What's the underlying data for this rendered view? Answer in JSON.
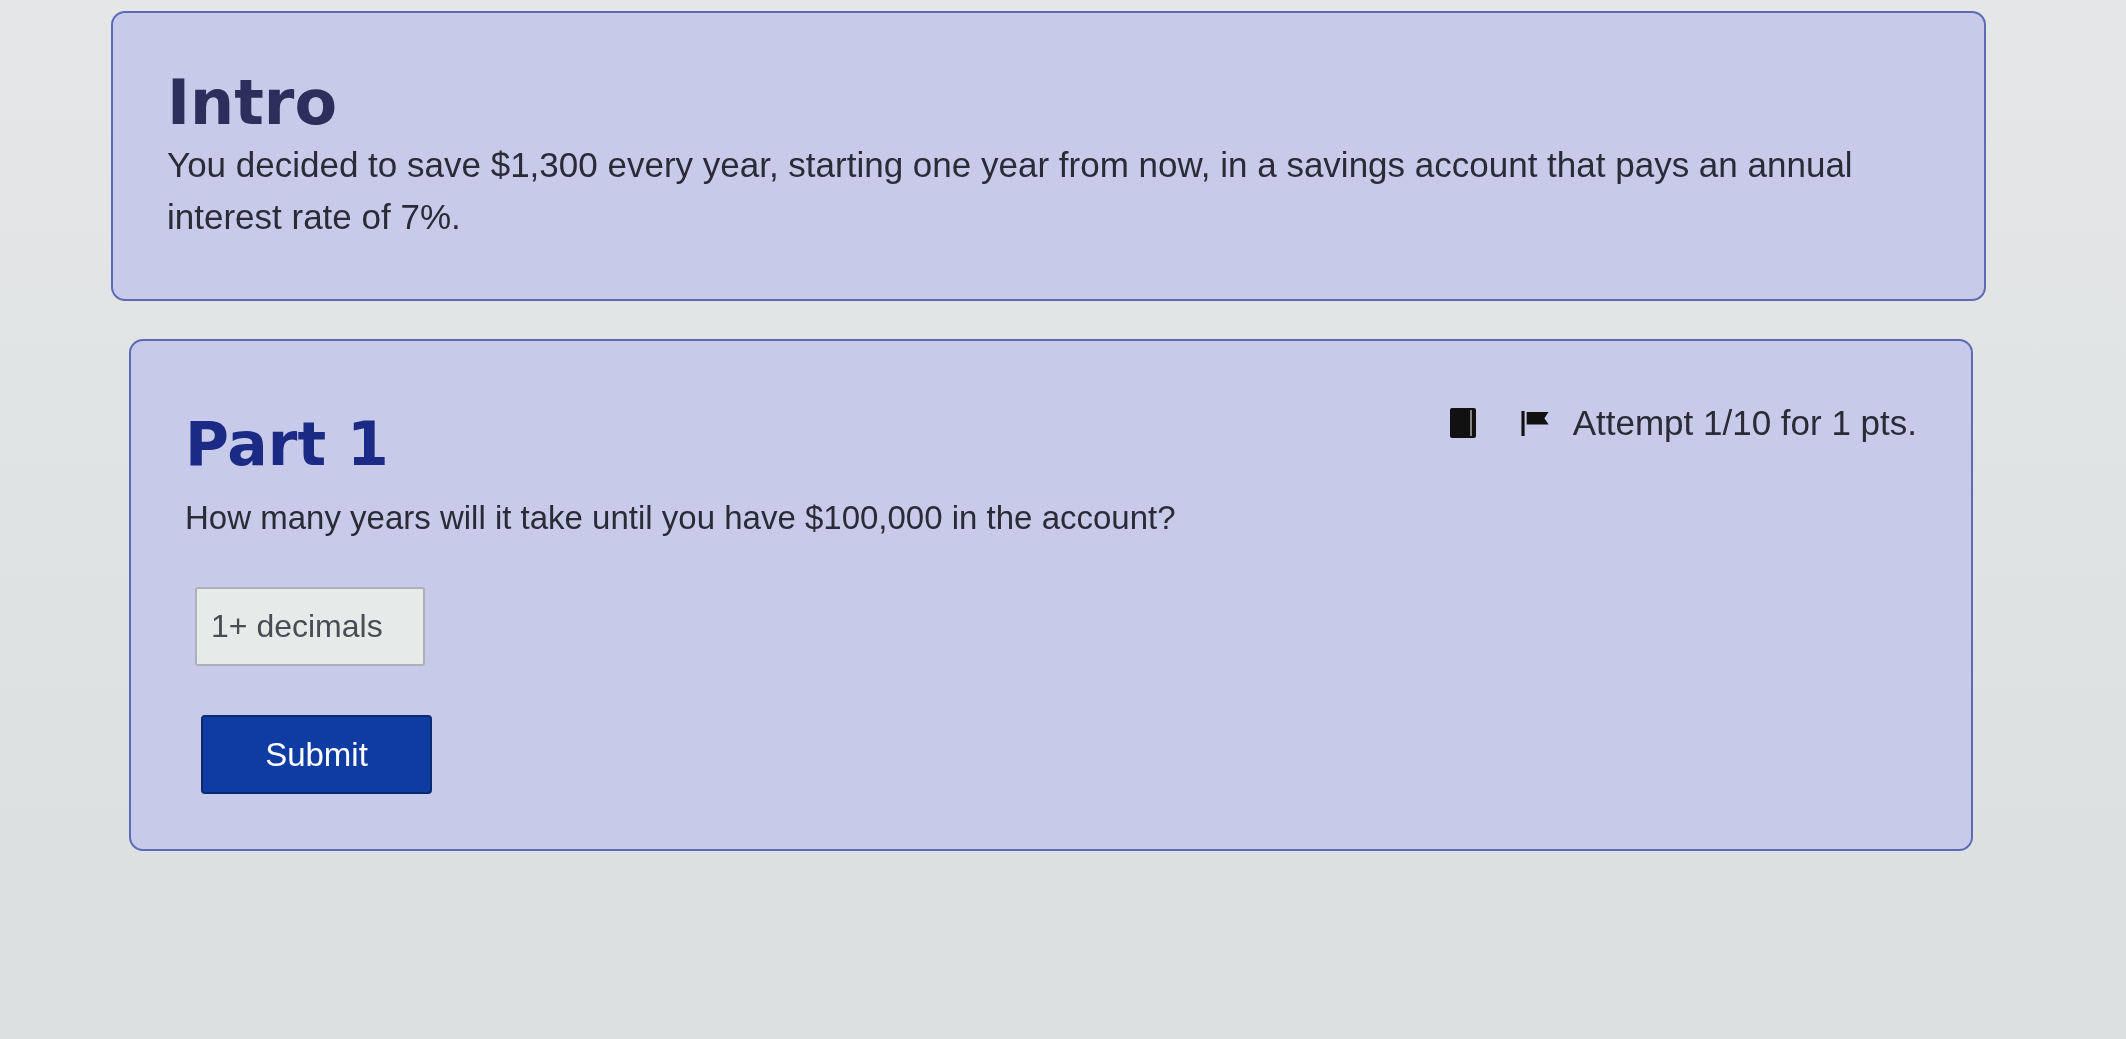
{
  "intro": {
    "title": "Intro",
    "text": "You decided to save $1,300 every year, starting one year from now, in a savings account that pays an annual interest rate of 7%."
  },
  "part": {
    "title": "Part 1",
    "attempt": "Attempt 1/10 for 1 pts.",
    "question": "How many years will it take until you have $100,000 in the account?",
    "answer": {
      "placeholder": "1+ decimals"
    },
    "submit": "Submit"
  }
}
